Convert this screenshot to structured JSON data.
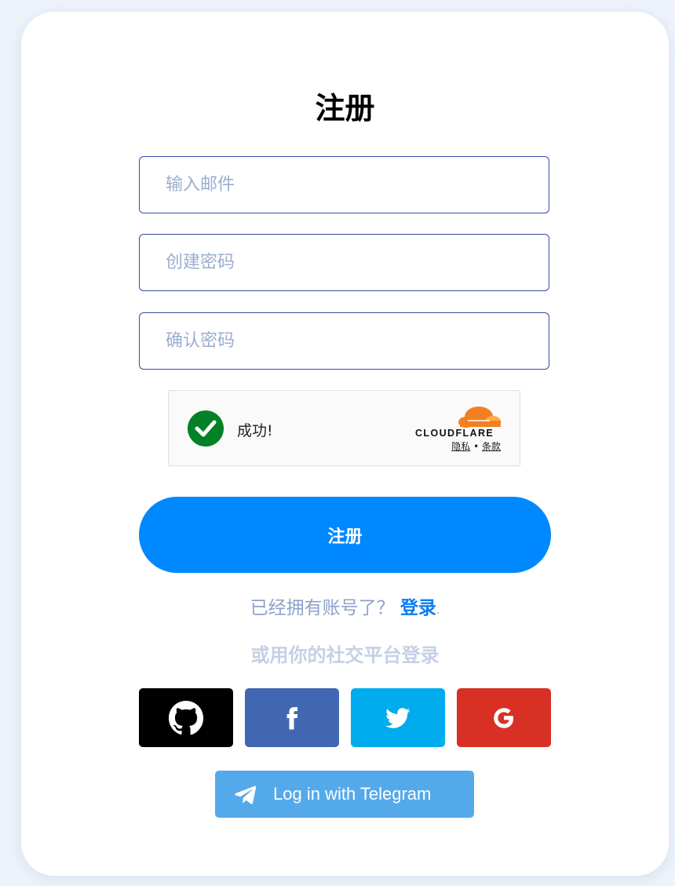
{
  "form": {
    "title": "注册",
    "email_placeholder": "输入邮件",
    "password_placeholder": "创建密码",
    "confirm_placeholder": "确认密码",
    "submit_label": "注册"
  },
  "captcha": {
    "status": "成功!",
    "brand": "CLOUDFLARE",
    "privacy_label": "隐私",
    "separator": "•",
    "terms_label": "条款",
    "status_color": "#038127"
  },
  "login_prompt": {
    "text": "已经拥有账号了？",
    "link_label": "登录",
    "suffix": "."
  },
  "social": {
    "title": "或用你的社交平台登录",
    "buttons": [
      {
        "name": "github",
        "icon": "github-icon",
        "color": "#000000"
      },
      {
        "name": "facebook",
        "icon": "facebook-icon",
        "color": "#4267b2"
      },
      {
        "name": "twitter",
        "icon": "twitter-icon",
        "color": "#00aced"
      },
      {
        "name": "google",
        "icon": "google-icon",
        "color": "#d93025"
      }
    ],
    "telegram_label": "Log in with Telegram"
  },
  "colors": {
    "primary": "#0088ff",
    "telegram": "#54a9eb",
    "input_border": "#2f4e9c"
  }
}
